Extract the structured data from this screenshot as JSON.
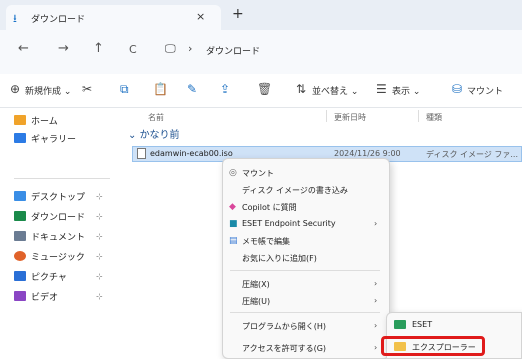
{
  "tab": {
    "title": "ダウンロード",
    "close": "×",
    "new_tab": "+"
  },
  "nav": {
    "back": "←",
    "forward": "→",
    "up": "↑",
    "refresh": "C",
    "pc_glyph": "🖵",
    "separator": "›",
    "path": "ダウンロード"
  },
  "toolbar": {
    "new_label": "新規作成",
    "sort_label": "並べ替え",
    "view_label": "表示",
    "mount_label": "マウント"
  },
  "sidebar": {
    "home": "ホーム",
    "gallery": "ギャラリー",
    "desktop": "デスクトップ",
    "downloads": "ダウンロード",
    "documents": "ドキュメント",
    "music": "ミュージック",
    "pictures": "ピクチャ",
    "videos": "ビデオ",
    "pin": "⊹"
  },
  "columns": {
    "name": "名前",
    "date": "更新日時",
    "type": "種類"
  },
  "group": {
    "label": "かなり前"
  },
  "file": {
    "name": "edamwin-ecab00.iso",
    "date": "2024/11/26 9:00",
    "type": "ディスク イメージ ファ..."
  },
  "context_menu": {
    "mount": "マウント",
    "burn": "ディスク イメージの書き込み",
    "copilot": "Copilot に質問",
    "eset": "ESET Endpoint Security",
    "notepad": "メモ帳で編集",
    "favorites": "お気に入りに追加(F)",
    "compress": "圧縮(X)",
    "compress_to": "圧縮(U)",
    "open_with": "プログラムから開く(H)",
    "access": "アクセスを許可する(G)",
    "arrow": "›"
  },
  "submenu": {
    "item1": "ESET",
    "item2": "エクスプローラー"
  },
  "colors": {
    "accent": "#1a6fc2",
    "highlight": "#e01b1b",
    "selection": "#cfe2f7"
  }
}
